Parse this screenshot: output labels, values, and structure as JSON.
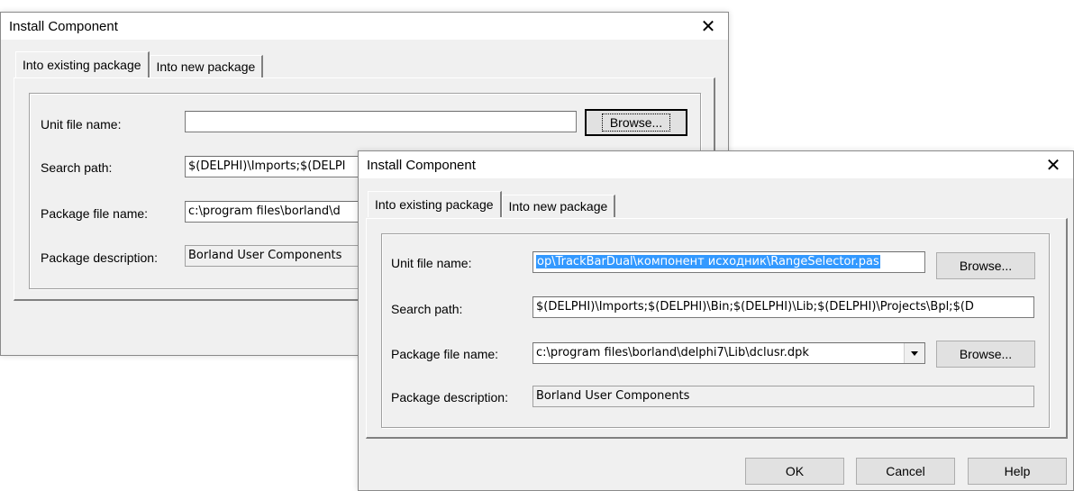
{
  "back_dialog": {
    "title": "Install Component",
    "close_glyph": "✕",
    "tabs": [
      "Into existing package",
      "Into new package"
    ],
    "labels": {
      "unit": "Unit file name:",
      "search": "Search path:",
      "package": "Package file name:",
      "description": "Package description:"
    },
    "values": {
      "unit": "",
      "search": "$(DELPHI)\\Imports;$(DELPI",
      "package": "c:\\program files\\borland\\d",
      "description": "Borland User Components"
    },
    "browse_label": "Browse..."
  },
  "front_dialog": {
    "title": "Install Component",
    "close_glyph": "✕",
    "tabs": [
      "Into existing package",
      "Into new package"
    ],
    "labels": {
      "unit": "Unit file name:",
      "search": "Search path:",
      "package": "Package file name:",
      "description": "Package description:"
    },
    "values": {
      "unit": "op\\TrackBarDual\\компонент исходник\\RangeSelector.pas",
      "search": "$(DELPHI)\\Imports;$(DELPHI)\\Bin;$(DELPHI)\\Lib;$(DELPHI)\\Projects\\Bpl;$(D",
      "package": "c:\\program files\\borland\\delphi7\\Lib\\dclusr.dpk",
      "description": "Borland User Components"
    },
    "browse_unit_label": "Browse...",
    "browse_package_label": "Browse...",
    "buttons": {
      "ok": "OK",
      "cancel": "Cancel",
      "help": "Help"
    }
  }
}
